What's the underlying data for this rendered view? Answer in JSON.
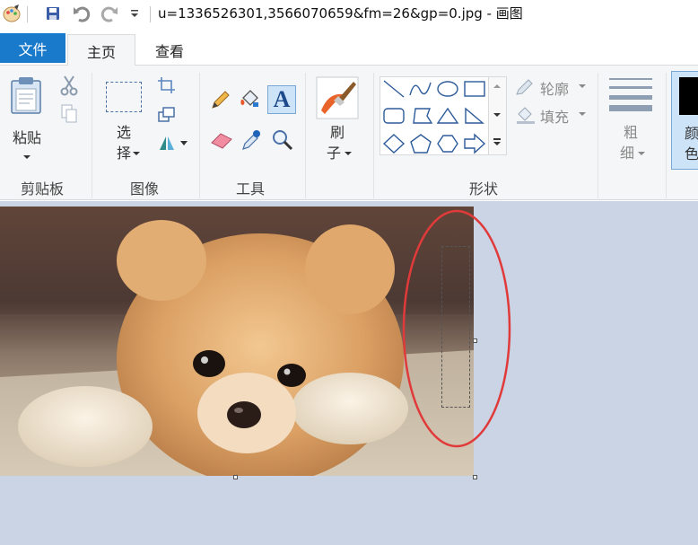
{
  "window": {
    "title": "u=1336526301,3566070659&fm=26&gp=0.jpg - 画图"
  },
  "quick_access": {
    "items": [
      "paint-app-icon",
      "save-icon",
      "undo-icon",
      "redo-icon",
      "customize-dropdown-icon"
    ]
  },
  "tabs": [
    {
      "label": "文件",
      "active": false
    },
    {
      "label": "主页",
      "active": true
    },
    {
      "label": "查看",
      "active": false
    }
  ],
  "ribbon": {
    "clipboard": {
      "group_label": "剪贴板",
      "paste_label": "粘贴"
    },
    "image": {
      "group_label": "图像",
      "select_label_1": "选",
      "select_label_2": "择"
    },
    "tools": {
      "group_label": "工具"
    },
    "brushes": {
      "label_1": "刷",
      "label_2": "子"
    },
    "shapes": {
      "group_label": "形状",
      "outline_label": "轮廓",
      "fill_label": "填充"
    },
    "size": {
      "label_1": "粗",
      "label_2": "细"
    },
    "colors": {
      "label_1": "颜",
      "label_2": "色"
    }
  },
  "colors": {
    "accent": "#1979ca",
    "annotation_red": "#e03a3a",
    "workspace_bg": "#cad4e4"
  }
}
